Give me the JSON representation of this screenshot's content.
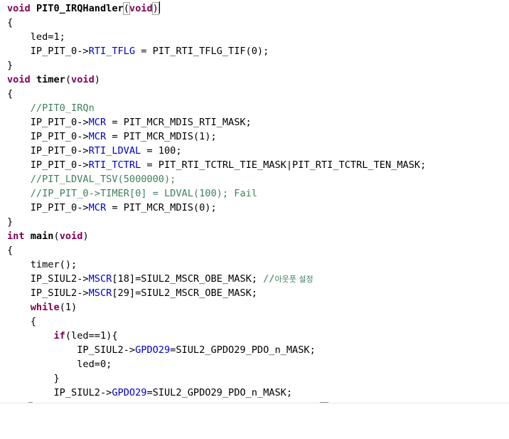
{
  "editor": {
    "lines": [
      {
        "text": "void PIT0_IRQHandler(void)"
      },
      {
        "text": "{"
      },
      {
        "text": "    led=1;"
      },
      {
        "text": "    IP_PIT_0->RTI_TFLG = PIT_RTI_TFLG_TIF(0);"
      },
      {
        "text": "}"
      },
      {
        "text": "void timer(void)"
      },
      {
        "text": "{"
      },
      {
        "text": "    //PIT0_IRQn"
      },
      {
        "text": "    IP_PIT_0->MCR = PIT_MCR_MDIS_RTI_MASK;"
      },
      {
        "text": "    IP_PIT_0->MCR = PIT_MCR_MDIS(1);"
      },
      {
        "text": "    IP_PIT_0->RTI_LDVAL = 100;"
      },
      {
        "text": "    IP_PIT_0->RTI_TCTRL = PIT_RTI_TCTRL_TIE_MASK|PIT_RTI_TCTRL_TEN_MASK;"
      },
      {
        "text": "    //PIT_LDVAL_TSV(5000000);"
      },
      {
        "text": "    //IP_PIT_0->TIMER[0] = LDVAL(100); Fail"
      },
      {
        "text": "    IP_PIT_0->MCR = PIT_MCR_MDIS(0);"
      },
      {
        "text": "}"
      },
      {
        "text": "int main(void)"
      },
      {
        "text": "{"
      },
      {
        "text": "    timer();"
      },
      {
        "text": "    IP_SIUL2->MSCR[18]=SIUL2_MSCR_OBE_MASK; //아웃풋 설정"
      },
      {
        "text": "    IP_SIUL2->MSCR[29]=SIUL2_MSCR_OBE_MASK;"
      },
      {
        "text": "    while(1)"
      },
      {
        "text": "    {"
      },
      {
        "text": "        if(led==1){"
      },
      {
        "text": "            IP_SIUL2->GPDO29=SIUL2_GPDO29_PDO_n_MASK;"
      },
      {
        "text": "            led=0;"
      },
      {
        "text": "        }"
      },
      {
        "text": "        IP_SIUL2->GPDO29=SIUL2_GPDO29_PDO_n_MASK;"
      }
    ]
  },
  "colors": {
    "keyword": "#7f0055",
    "field": "#0000c0",
    "comment": "#3f7f5f",
    "text": "#000000",
    "background": "#ffffff"
  }
}
